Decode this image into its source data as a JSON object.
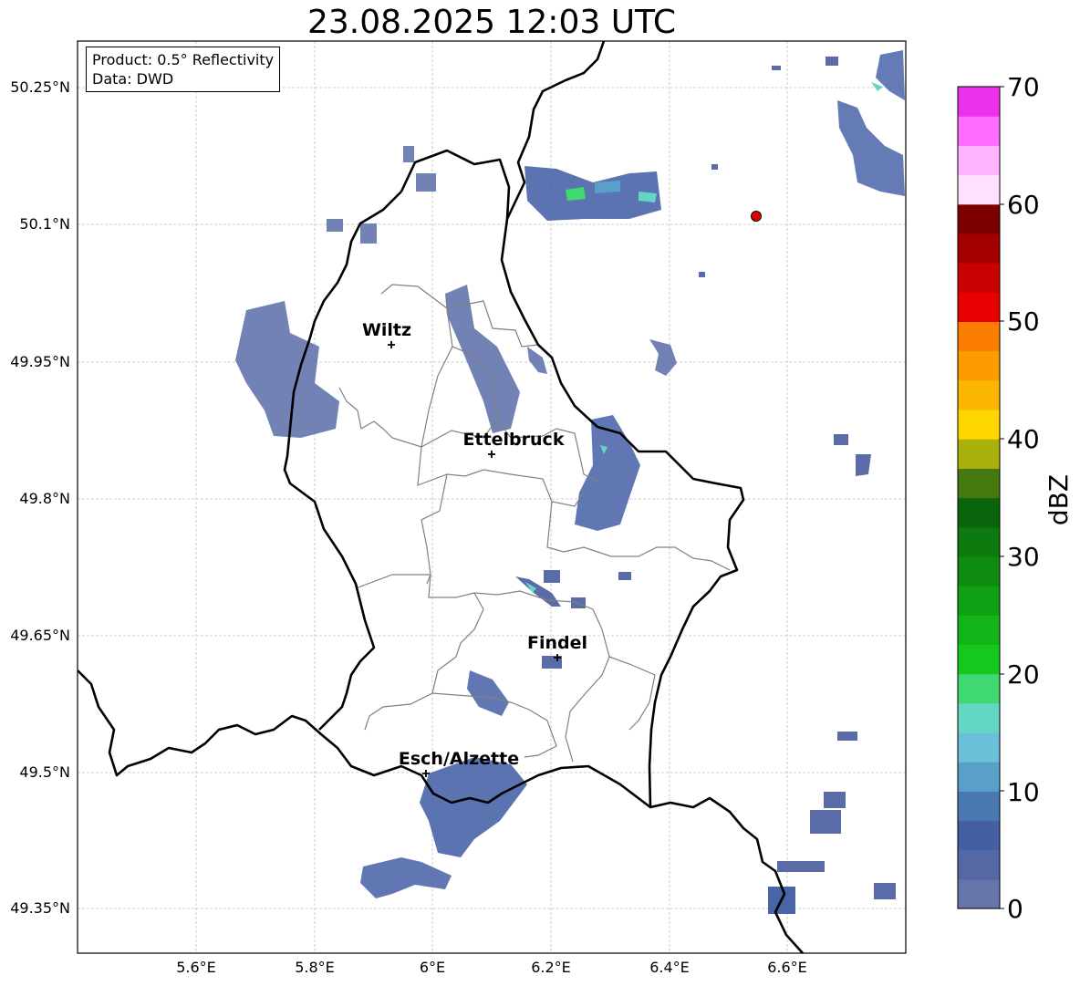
{
  "title": "23.08.2025 12:03 UTC",
  "info": {
    "product": "Product: 0.5° Reflectivity",
    "data_source": "Data: DWD"
  },
  "lat_ticks": [
    "50.25°N",
    "50.1°N",
    "49.95°N",
    "49.8°N",
    "49.65°N",
    "49.5°N",
    "49.35°N"
  ],
  "lon_ticks": [
    "5.6°E",
    "5.8°E",
    "6°E",
    "6.2°E",
    "6.4°E",
    "6.6°E"
  ],
  "cities": [
    {
      "name": "Wiltz",
      "lat": 49.968,
      "lon": 5.935
    },
    {
      "name": "Ettelbruck",
      "lat": 49.849,
      "lon": 6.105
    },
    {
      "name": "Findel",
      "lat": 49.627,
      "lon": 6.211
    },
    {
      "name": "Esch/Alzette",
      "lat": 49.498,
      "lon": 5.99
    }
  ],
  "marker": {
    "lat": 50.109,
    "lon": 6.548,
    "color": "#e00000"
  },
  "colorbar": {
    "label": "dBZ",
    "ticks": [
      "0",
      "10",
      "20",
      "30",
      "40",
      "50",
      "60",
      "70"
    ],
    "colors": [
      "#6675aa",
      "#5568a6",
      "#4460a3",
      "#4a78b0",
      "#58a0c8",
      "#6ac0d8",
      "#64d6c4",
      "#40d870",
      "#14c81e",
      "#12b41a",
      "#10a014",
      "#0e8c10",
      "#0c7a0e",
      "#0a640c",
      "#467a10",
      "#aab00c",
      "#ffd700",
      "#fcb800",
      "#fc9c00",
      "#fc7e00",
      "#e80000",
      "#c80000",
      "#a40000",
      "#7c0000",
      "#ffe0ff",
      "#ffb4ff",
      "#ff6cff",
      "#ec30ec"
    ]
  },
  "legend_colors": {
    "border_country": "#000000",
    "border_canton": "#808080",
    "grid": "#c0c0c0"
  }
}
